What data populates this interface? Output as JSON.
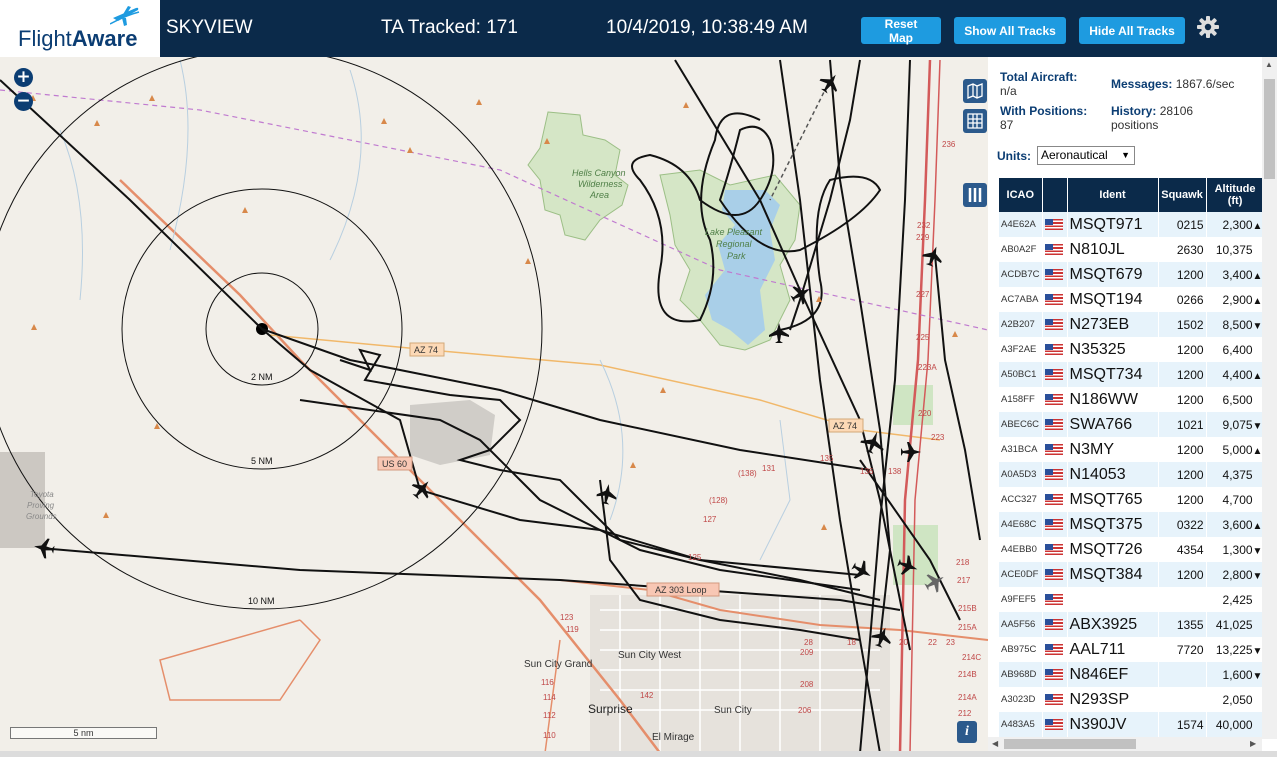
{
  "header": {
    "logo_text_a": "Flight",
    "logo_text_b": "Aware",
    "site_name": "SKYVIEW",
    "tracked": "TA Tracked: 171",
    "datetime": "10/4/2019, 10:38:49 AM",
    "reset_map": "Reset Map",
    "show_all": "Show All Tracks",
    "hide_all": "Hide All Tracks",
    "settings_icon": "gear-icon",
    "brand_color": "#0b2a4a",
    "button_color": "#1e9be0"
  },
  "map": {
    "zoom_in": "+",
    "zoom_out": "−",
    "scale": "5 nm",
    "info": "i",
    "rings": [
      "2 NM",
      "5 NM",
      "10 NM"
    ],
    "labels": {
      "hells_canyon_1": "Hells Canyon",
      "hells_canyon_2": "Wilderness",
      "hells_canyon_3": "Area",
      "lake_pleasant_1": "Lake Pleasant",
      "lake_pleasant_2": "Regional",
      "lake_pleasant_3": "Park",
      "az74_a": "AZ 74",
      "az74_b": "AZ 74",
      "us60": "US 60",
      "az303": "AZ 303 Loop",
      "toyota_1": "Toyota",
      "toyota_2": "Proving",
      "toyota_3": "Grounds",
      "sun_city_grand": "Sun City Grand",
      "sun_city_west": "Sun City West",
      "sun_city": "Sun City",
      "surprise": "Surprise",
      "el_mirage": "El Mirage"
    },
    "road_numbers": [
      "236",
      "232",
      "229",
      "227",
      "225",
      "223A",
      "223",
      "220",
      "218",
      "217",
      "215B",
      "215A",
      "214C",
      "214B",
      "214A",
      "212",
      "210",
      "209",
      "208",
      "206",
      "131",
      "135",
      "136",
      "138",
      "(138)",
      "(128)",
      "127",
      "125",
      "123",
      "119",
      "116",
      "114",
      "112",
      "110",
      "142",
      "18",
      "20",
      "22",
      "23",
      "28"
    ],
    "map_icons": [
      "map-layer-icon",
      "grid-icon",
      "columns-icon"
    ]
  },
  "panel": {
    "total_aircraft_label": "Total Aircraft:",
    "total_aircraft_value": "n/a",
    "with_positions_label": "With Positions:",
    "with_positions_value": "87",
    "messages_label": "Messages:",
    "messages_value": "1867.6/sec",
    "history_label": "History:",
    "history_value": "28106",
    "history_unit": "positions",
    "units_label": "Units:",
    "units_value": "Aeronautical",
    "columns": [
      "ICAO",
      "",
      "Ident",
      "Squawk",
      "Altitude (ft)"
    ],
    "rows": [
      {
        "icao": "A4E62A",
        "ident": "MSQT971",
        "squawk": "0215",
        "alt": "2,300",
        "trend": "▲"
      },
      {
        "icao": "AB0A2F",
        "ident": "N810JL",
        "squawk": "2630",
        "alt": "10,375",
        "trend": ""
      },
      {
        "icao": "ACDB7C",
        "ident": "MSQT679",
        "squawk": "1200",
        "alt": "3,400",
        "trend": "▲"
      },
      {
        "icao": "AC7ABA",
        "ident": "MSQT194",
        "squawk": "0266",
        "alt": "2,900",
        "trend": "▲"
      },
      {
        "icao": "A2B207",
        "ident": "N273EB",
        "squawk": "1502",
        "alt": "8,500",
        "trend": "▼"
      },
      {
        "icao": "A3F2AE",
        "ident": "N35325",
        "squawk": "1200",
        "alt": "6,400",
        "trend": ""
      },
      {
        "icao": "A50BC1",
        "ident": "MSQT734",
        "squawk": "1200",
        "alt": "4,400",
        "trend": "▲"
      },
      {
        "icao": "A158FF",
        "ident": "N186WW",
        "squawk": "1200",
        "alt": "6,500",
        "trend": ""
      },
      {
        "icao": "ABEC6C",
        "ident": "SWA766",
        "squawk": "1021",
        "alt": "9,075",
        "trend": "▼"
      },
      {
        "icao": "A31BCA",
        "ident": "N3MY",
        "squawk": "1200",
        "alt": "5,000",
        "trend": "▲"
      },
      {
        "icao": "A0A5D3",
        "ident": "N14053",
        "squawk": "1200",
        "alt": "4,375",
        "trend": ""
      },
      {
        "icao": "ACC327",
        "ident": "MSQT765",
        "squawk": "1200",
        "alt": "4,700",
        "trend": ""
      },
      {
        "icao": "A4E68C",
        "ident": "MSQT375",
        "squawk": "0322",
        "alt": "3,600",
        "trend": "▲"
      },
      {
        "icao": "A4EBB0",
        "ident": "MSQT726",
        "squawk": "4354",
        "alt": "1,300",
        "trend": "▼"
      },
      {
        "icao": "ACE0DF",
        "ident": "MSQT384",
        "squawk": "1200",
        "alt": "2,800",
        "trend": "▼"
      },
      {
        "icao": "A9FEF5",
        "ident": "",
        "squawk": "",
        "alt": "2,425",
        "trend": ""
      },
      {
        "icao": "AA5F56",
        "ident": "ABX3925",
        "squawk": "1355",
        "alt": "41,025",
        "trend": ""
      },
      {
        "icao": "AB975C",
        "ident": "AAL711",
        "squawk": "7720",
        "alt": "13,225",
        "trend": "▼"
      },
      {
        "icao": "AB968D",
        "ident": "N846EF",
        "squawk": "",
        "alt": "1,600",
        "trend": "▼"
      },
      {
        "icao": "A3023D",
        "ident": "N293SP",
        "squawk": "",
        "alt": "2,050",
        "trend": ""
      },
      {
        "icao": "A483A5",
        "ident": "N390JV",
        "squawk": "1574",
        "alt": "40,000",
        "trend": ""
      }
    ]
  }
}
